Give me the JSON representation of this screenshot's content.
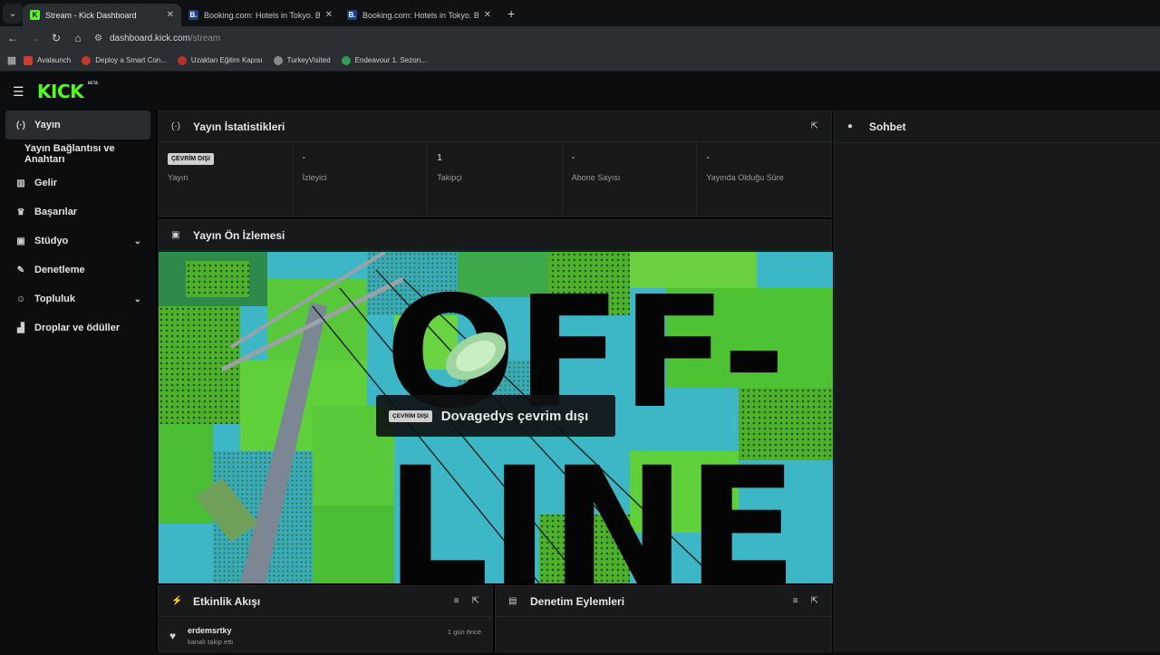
{
  "browser": {
    "tabs": [
      {
        "title": "Stream - Kick Dashboard",
        "favicon": "K",
        "active": true
      },
      {
        "title": "Booking.com: Hotels in Tokyo. B",
        "favicon": "B.",
        "active": false
      },
      {
        "title": "Booking.com: Hotels in Tokyo. B",
        "favicon": "B.",
        "active": false
      }
    ],
    "url_host": "dashboard.kick.com",
    "url_path": "/stream",
    "bookmarks": [
      "Avalaunch",
      "Deploy a Smart Con...",
      "Uzaktan Eğitim Kapısı",
      "TurkeyVisited",
      "Endeavour 1. Sezon..."
    ]
  },
  "logo": {
    "text": "KICK",
    "badge": "BETA"
  },
  "sidebar": {
    "items": [
      {
        "label": "Yayın",
        "icon": "broadcast-icon"
      },
      {
        "label": "Yayın Bağlantısı ve Anahtarı"
      },
      {
        "label": "Gelir",
        "icon": "revenue-icon"
      },
      {
        "label": "Başarılar",
        "icon": "trophy-icon"
      },
      {
        "label": "Stüdyo",
        "icon": "studio-icon"
      },
      {
        "label": "Denetleme",
        "icon": "wrench-icon"
      },
      {
        "label": "Topluluk",
        "icon": "community-icon"
      },
      {
        "label": "Droplar ve ödüller",
        "icon": "drops-icon"
      }
    ]
  },
  "stats_panel": {
    "title": "Yayın İstatistikleri",
    "stats": [
      {
        "value": "ÇEVRİM DIŞI",
        "label": "Yayın"
      },
      {
        "value": "-",
        "label": "İzleyici"
      },
      {
        "value": "1",
        "label": "Takipçi"
      },
      {
        "value": "-",
        "label": "Abone Sayısı"
      },
      {
        "value": "-",
        "label": "Yayında Olduğu Süre"
      }
    ]
  },
  "preview_panel": {
    "title": "Yayın Ön İzlemesi",
    "badge": "ÇEVRİM DIŞI",
    "status_text": "Dovagedys çevrim dışı",
    "art_text_top": "OFF-",
    "art_text_bottom": "LINE"
  },
  "activity_panel": {
    "title": "Etkinlik Akışı",
    "items": [
      {
        "user": "erdemsrtky",
        "desc": "kanalı takip etti",
        "time": "1 gün önce"
      }
    ]
  },
  "moderation_panel": {
    "title": "Denetim Eylemleri"
  },
  "chat_panel": {
    "title": "Sohbet"
  },
  "colors": {
    "accent": "#53fc18",
    "panel": "#17191b",
    "background": "#0b0d0e"
  }
}
